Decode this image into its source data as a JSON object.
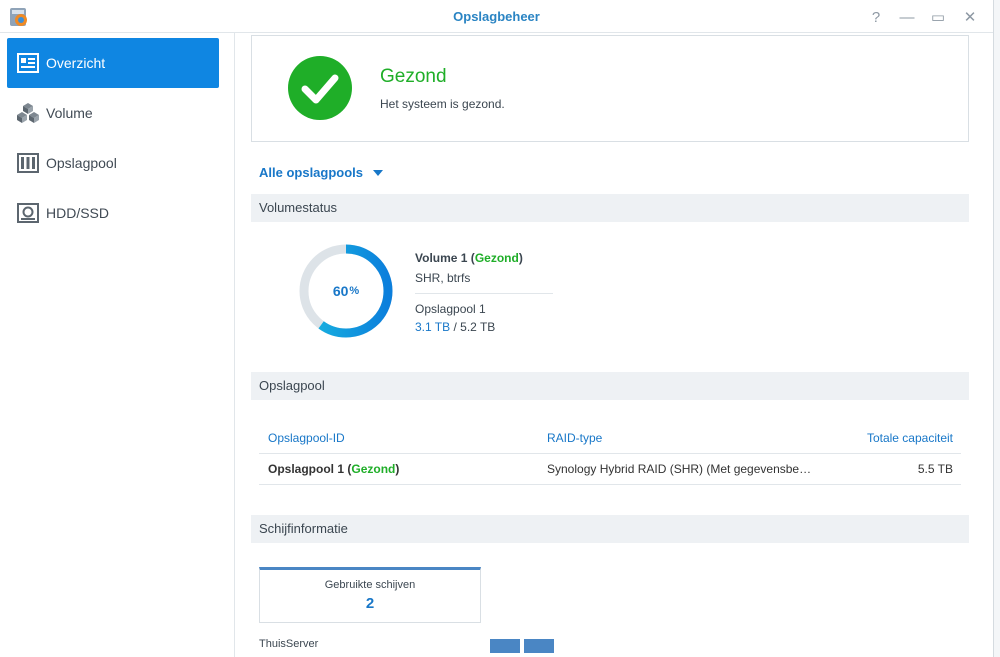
{
  "window": {
    "title": "Opslagbeheer"
  },
  "titlebar_buttons": {
    "help": "?",
    "minimize": "—",
    "maximize": "▭",
    "close": "✕"
  },
  "sidebar": {
    "items": [
      {
        "label": "Overzicht",
        "icon": "overview-icon",
        "active": true
      },
      {
        "label": "Volume",
        "icon": "cubes-icon",
        "active": false
      },
      {
        "label": "Opslagpool",
        "icon": "storage-pool-icon",
        "active": false
      },
      {
        "label": "HDD/SSD",
        "icon": "hard-disk-icon",
        "active": false
      }
    ]
  },
  "status": {
    "title": "Gezond",
    "subtitle": "Het systeem is gezond."
  },
  "pool_filter": {
    "label": "Alle opslagpools"
  },
  "volume_status": {
    "header": "Volumestatus",
    "usage_percent": 60,
    "usage_value": "60",
    "usage_unit": "%",
    "volume_name": "Volume 1",
    "volume_state": "Gezond",
    "volume_type": "SHR, btrfs",
    "pool_name": "Opslagpool 1",
    "used": "3.1 TB",
    "total": "5.2 TB"
  },
  "storage_pool": {
    "header": "Opslagpool",
    "columns": [
      "Opslagpool-ID",
      "RAID-type",
      "Totale capaciteit"
    ],
    "rows": [
      {
        "id": "Opslagpool 1",
        "state": "Gezond",
        "raid": "Synology Hybrid RAID (SHR) (Met gegevensbescherming)",
        "capacity": "5.5 TB"
      }
    ]
  },
  "disk_info": {
    "header": "Schijfinformatie",
    "used_label": "Gebruikte schijven",
    "used_count": "2",
    "server_name": "ThuisServer"
  },
  "colors": {
    "accent": "#0f86e2",
    "healthy": "#1fae28",
    "link": "#1877c8"
  }
}
